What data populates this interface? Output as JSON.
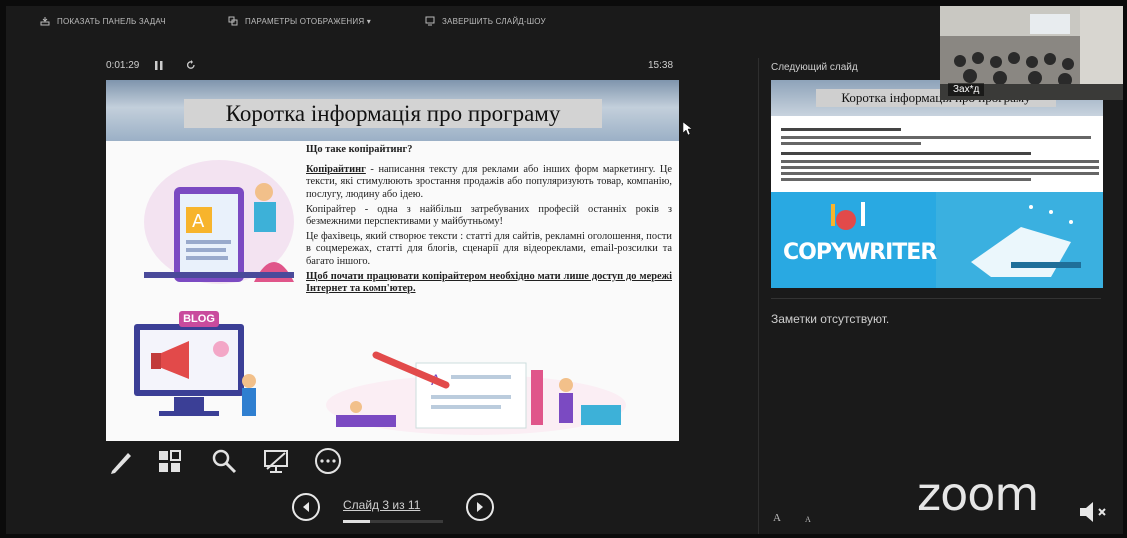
{
  "toolbar": {
    "show_taskbar": "ПОКАЗАТЬ ПАНЕЛЬ ЗАДАЧ",
    "display_settings": "ПАРАМЕТРЫ ОТОБРАЖЕНИЯ ▾",
    "end_show": "ЗАВЕРШИТЬ СЛАЙД-ШОУ"
  },
  "timer": {
    "elapsed": "0:01:29",
    "clock": "15:38"
  },
  "slide": {
    "title": "Коротка інформація про програму",
    "question": "Що таке копірайтинг?",
    "p1_bold": "Копірайтинг",
    "p1_rest": " - написання тексту для реклами або інших форм маркетингу. Це тексти, які стимулюють зростання продажів або популяризують товар, компанію, послугу, людину або ідею.",
    "p2": "Копірайтер - одна з найбільш затребуваних професій останніх років з безмежними перспективами у майбутньому!",
    "p3": "Це фахівець, який створює тексти : статті для сайтів, рекламні оголошення, пости в соцмережах, статті для блогів, сценарії для відеореклами, email-розсилки та багато іншого.",
    "p4": "Щоб почати працювати копірайтером необхідно мати лише доступ до мережі Інтернет та комп'ютер.",
    "blog_label": "BLOG"
  },
  "navigation": {
    "counter": "Слайд 3 из 11",
    "progress": 0.2727
  },
  "next_slide": {
    "label": "Следующий слайд",
    "title": "Коротка інформація про програму",
    "copywriter": "COPYWRITER"
  },
  "notes": {
    "text": "Заметки отсутствуют."
  },
  "font_controls": {
    "increase": "A",
    "decrease": "A"
  },
  "video": {
    "participant": "Зах*д"
  },
  "zoom": {
    "logo": "zoom"
  },
  "colors": {
    "background": "#1a1a1a",
    "slide_header": "#9bb0c6",
    "next_slide_accent": "#29a9e2"
  }
}
